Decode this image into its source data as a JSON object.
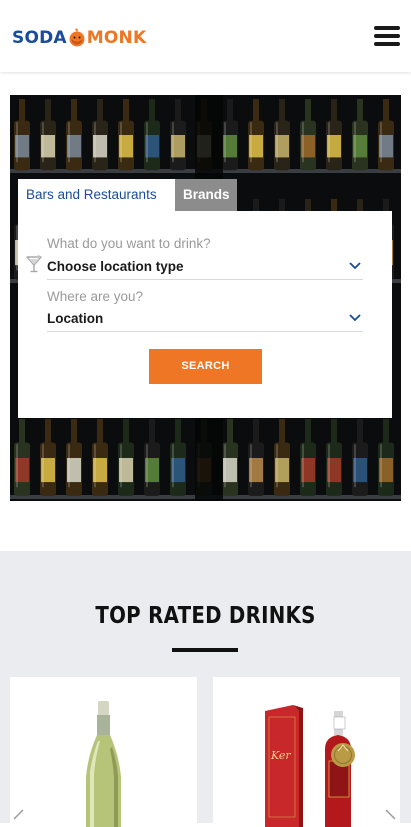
{
  "header": {
    "logo": {
      "part1": "SODA",
      "part2": "MONK"
    },
    "menu_icon": "hamburger-menu-icon"
  },
  "search": {
    "tabs": [
      {
        "label": "Bars and Restaurants",
        "active": true
      },
      {
        "label": "Brands",
        "active": false
      }
    ],
    "drink_field": {
      "label": "What do you want to drink?",
      "value": "Choose location type",
      "icon": "cocktail-icon"
    },
    "location_field": {
      "label": "Where are you?",
      "value": "Location"
    },
    "button_label": "SEARCH"
  },
  "top_rated": {
    "title": "TOP RATED DRINKS",
    "products": [
      {
        "image": "white-wine-bottle"
      },
      {
        "image": "red-box-liquor-bottle"
      }
    ]
  },
  "colors": {
    "brand_blue": "#1a4b9c",
    "brand_orange": "#ee7624",
    "tab_inactive": "#8c8c8c",
    "section_bg": "#ebecef"
  }
}
